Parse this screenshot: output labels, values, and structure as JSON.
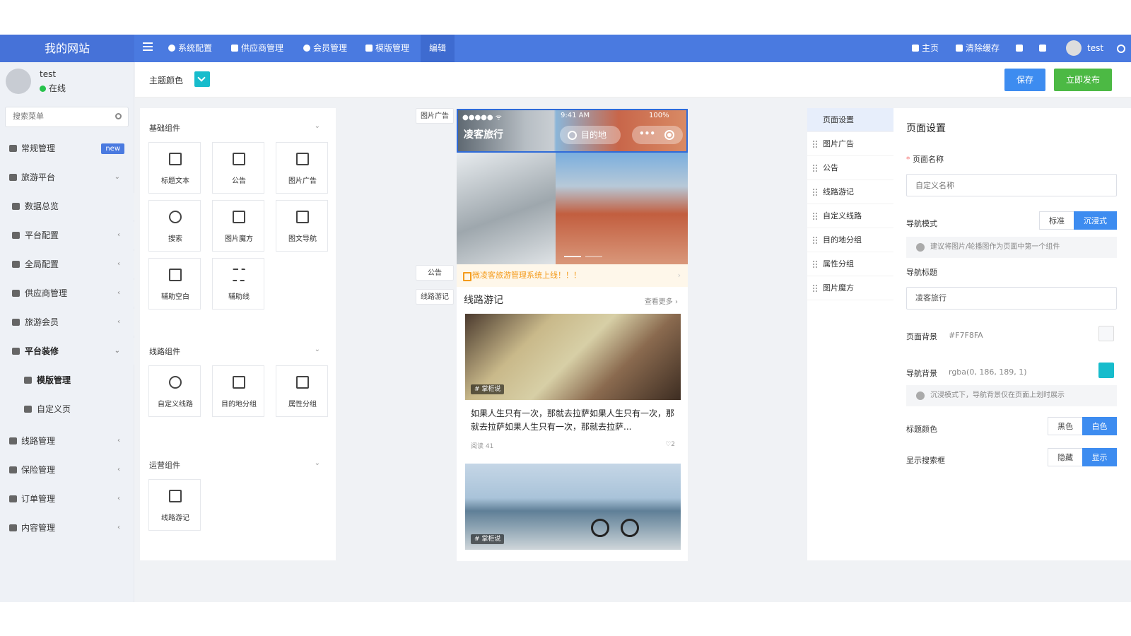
{
  "header": {
    "logo": "我的网站",
    "nav": [
      "系统配置",
      "供应商管理",
      "会员管理",
      "模版管理",
      "编辑"
    ],
    "right": {
      "home": "主页",
      "clear_cache": "清除缓存",
      "user": "test"
    }
  },
  "sidebar": {
    "user": {
      "name": "test",
      "status": "在线"
    },
    "search_placeholder": "搜索菜单",
    "items": [
      {
        "label": "常规管理",
        "badge": "new"
      },
      {
        "label": "旅游平台"
      },
      {
        "label": "数据总览"
      },
      {
        "label": "平台配置"
      },
      {
        "label": "全局配置"
      },
      {
        "label": "供应商管理"
      },
      {
        "label": "旅游会员"
      },
      {
        "label": "平台装修"
      },
      {
        "label": "模版管理"
      },
      {
        "label": "自定义页"
      },
      {
        "label": "线路管理"
      },
      {
        "label": "保险管理"
      },
      {
        "label": "订单管理"
      },
      {
        "label": "内容管理"
      }
    ]
  },
  "toolbar": {
    "theme_label": "主题颜色",
    "theme_color": "#17bccc",
    "save": "保存",
    "publish": "立即发布"
  },
  "components": {
    "groups": [
      {
        "title": "基础组件",
        "items": [
          "标题文本",
          "公告",
          "图片广告",
          "搜索",
          "图片魔方",
          "图文导航",
          "辅助空白",
          "辅助线"
        ]
      },
      {
        "title": "线路组件",
        "items": [
          "自定义线路",
          "目的地分组",
          "属性分组"
        ]
      },
      {
        "title": "运营组件",
        "items": [
          "线路游记"
        ]
      }
    ]
  },
  "preview": {
    "side_labels": [
      "图片广告",
      "公告",
      "线路游记"
    ],
    "status": {
      "signal": "●●●●● ᯤ",
      "time": "9:41 AM",
      "battery": "100%"
    },
    "nav_title": "凌客旅行",
    "search_text": "目的地",
    "capsule_dots": "•••",
    "notice": "微凌客旅游管理系统上线！！！",
    "section_title": "线路游记",
    "more": "查看更多",
    "cards": [
      {
        "tag": "# 掌柜说",
        "title": "如果人生只有一次，那就去拉萨如果人生只有一次，那就去拉萨如果人生只有一次，那就去拉萨...",
        "reads": "阅读 41",
        "likes": "2"
      },
      {
        "tag": "# 掌柜说"
      }
    ]
  },
  "right_tabs": [
    "页面设置",
    "图片广告",
    "公告",
    "线路游记",
    "自定义线路",
    "目的地分组",
    "属性分组",
    "图片魔方"
  ],
  "settings": {
    "title": "页面设置",
    "page_name_label": "页面名称",
    "page_name_placeholder": "自定义名称",
    "nav_mode_label": "导航模式",
    "nav_mode_options": [
      "标准",
      "沉浸式"
    ],
    "nav_mode_selected": "沉浸式",
    "nav_mode_hint": "建议将图片/轮播图作为页面中第一个组件",
    "nav_title_label": "导航标题",
    "nav_title_value": "凌客旅行",
    "page_bg_label": "页面背景",
    "page_bg_value": "#F7F8FA",
    "nav_bg_label": "导航背景",
    "nav_bg_value": "rgba(0, 186, 189, 1)",
    "nav_bg_hint": "沉浸模式下，导航背景仅在页面上划时展示",
    "title_color_label": "标题颜色",
    "title_color_options": [
      "黑色",
      "白色"
    ],
    "title_color_selected": "白色",
    "search_label": "显示搜索框",
    "search_options": [
      "隐藏",
      "显示"
    ],
    "search_selected": "显示"
  },
  "colors": {
    "header": "#4a7ae0",
    "primary": "#3d8cf0",
    "publish": "#4cb944",
    "nav_bg": "#17bccc",
    "notice": "#f49b1b"
  }
}
